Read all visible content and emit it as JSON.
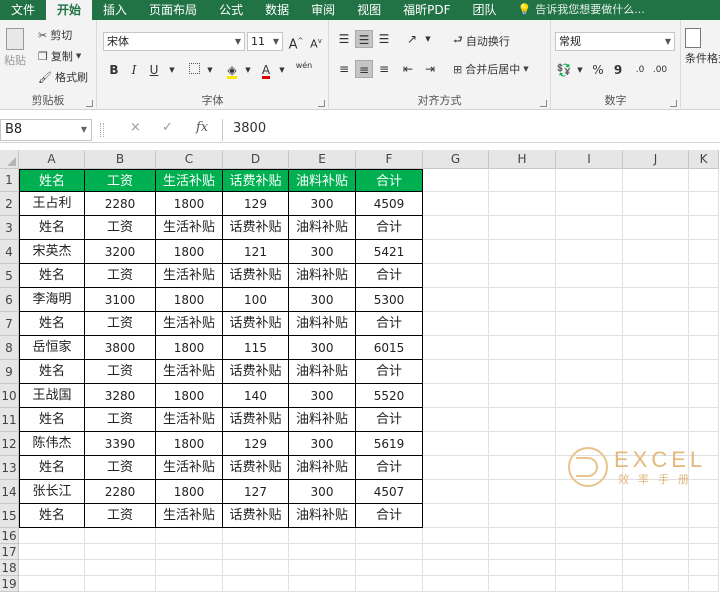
{
  "tabs": [
    "文件",
    "开始",
    "插入",
    "页面布局",
    "公式",
    "数据",
    "审阅",
    "视图",
    "福昕PDF",
    "团队"
  ],
  "active_tab": "开始",
  "tell_me": "告诉我您想要做什么...",
  "clipboard": {
    "paste": "粘贴",
    "cut": "剪切",
    "copy": "复制",
    "format_painter": "格式刷",
    "label": "剪贴板"
  },
  "font": {
    "name": "宋体",
    "size": "11",
    "bold": "B",
    "italic": "I",
    "underline": "U",
    "grow": "A",
    "shrink": "A",
    "wen": "wén",
    "label": "字体"
  },
  "alignment": {
    "wrap": "自动换行",
    "merge": "合并后居中",
    "label": "对齐方式"
  },
  "number": {
    "format": "常规",
    "percent": "%",
    "comma": "9",
    "label": "数字"
  },
  "styles": {
    "conditional": "条件格式"
  },
  "formula_bar": {
    "name_box": "B8",
    "cancel": "×",
    "enter": "✓",
    "fx": "fx",
    "value": "3800"
  },
  "columns": [
    "A",
    "B",
    "C",
    "D",
    "E",
    "F",
    "G",
    "H",
    "I",
    "J",
    "K"
  ],
  "rows": [
    "1",
    "2",
    "3",
    "4",
    "5",
    "6",
    "7",
    "8",
    "9",
    "10",
    "11",
    "12",
    "13",
    "14",
    "15",
    "16",
    "17",
    "18",
    "19"
  ],
  "table": [
    [
      "姓名",
      "工资",
      "生活补贴",
      "话费补贴",
      "油料补贴",
      "合计"
    ],
    [
      "王占利",
      "2280",
      "1800",
      "129",
      "300",
      "4509"
    ],
    [
      "姓名",
      "工资",
      "生活补贴",
      "话费补贴",
      "油料补贴",
      "合计"
    ],
    [
      "宋英杰",
      "3200",
      "1800",
      "121",
      "300",
      "5421"
    ],
    [
      "姓名",
      "工资",
      "生活补贴",
      "话费补贴",
      "油料补贴",
      "合计"
    ],
    [
      "李海明",
      "3100",
      "1800",
      "100",
      "300",
      "5300"
    ],
    [
      "姓名",
      "工资",
      "生活补贴",
      "话费补贴",
      "油料补贴",
      "合计"
    ],
    [
      "岳恒家",
      "3800",
      "1800",
      "115",
      "300",
      "6015"
    ],
    [
      "姓名",
      "工资",
      "生活补贴",
      "话费补贴",
      "油料补贴",
      "合计"
    ],
    [
      "王战国",
      "3280",
      "1800",
      "140",
      "300",
      "5520"
    ],
    [
      "姓名",
      "工资",
      "生活补贴",
      "话费补贴",
      "油料补贴",
      "合计"
    ],
    [
      "陈伟杰",
      "3390",
      "1800",
      "129",
      "300",
      "5619"
    ],
    [
      "姓名",
      "工资",
      "生活补贴",
      "话费补贴",
      "油料补贴",
      "合计"
    ],
    [
      "张长江",
      "2280",
      "1800",
      "127",
      "300",
      "4507"
    ],
    [
      "姓名",
      "工资",
      "生活补贴",
      "话费补贴",
      "油料补贴",
      "合计"
    ]
  ],
  "watermark": {
    "line1": "EXCEL",
    "line2": "效率手册"
  },
  "colors": {
    "ribbon_green": "#217346",
    "header_fill": "#00b050"
  }
}
